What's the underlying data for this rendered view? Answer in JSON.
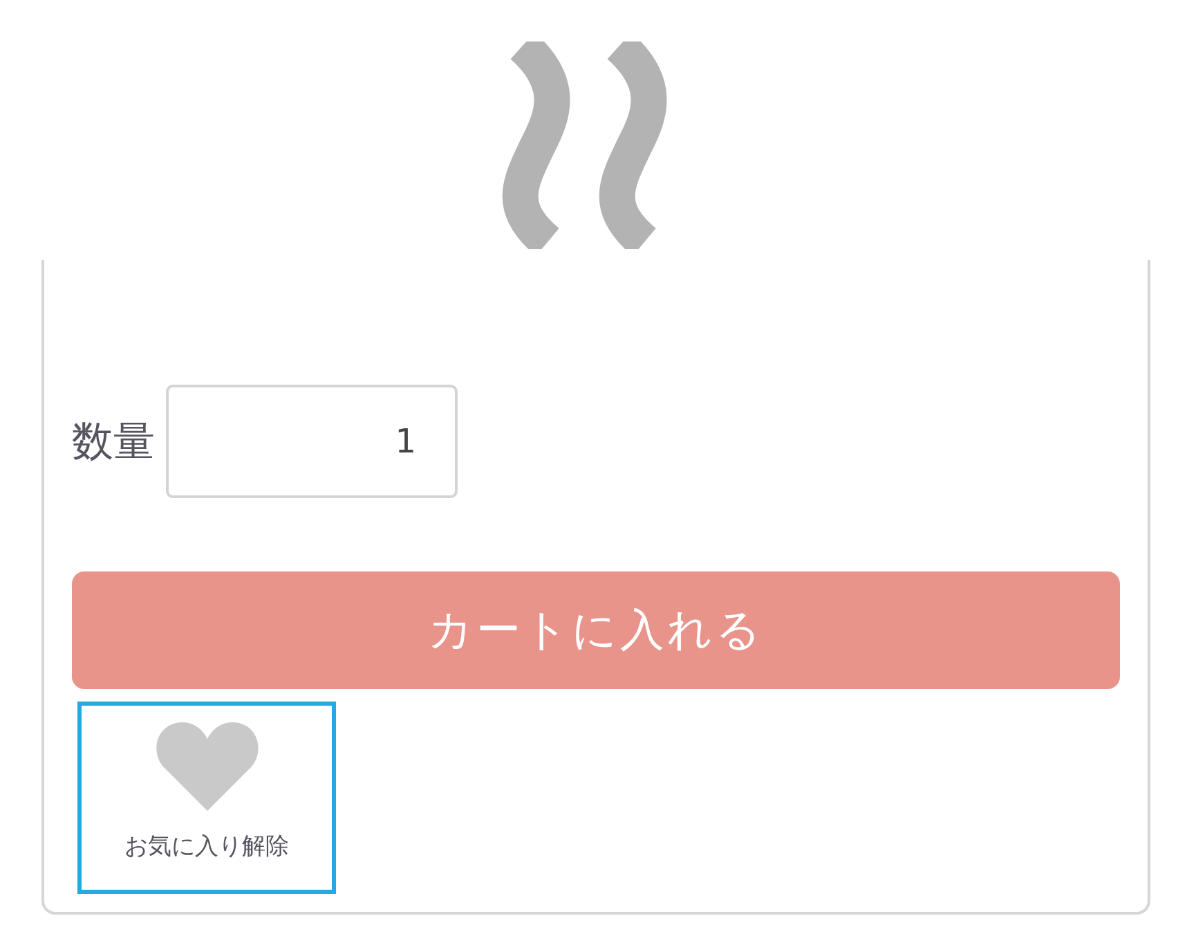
{
  "quantity": {
    "label": "数量",
    "value": "1"
  },
  "cart_button": {
    "label": "カートに入れる"
  },
  "favorite": {
    "label": "お気に入り解除",
    "focused": true
  }
}
